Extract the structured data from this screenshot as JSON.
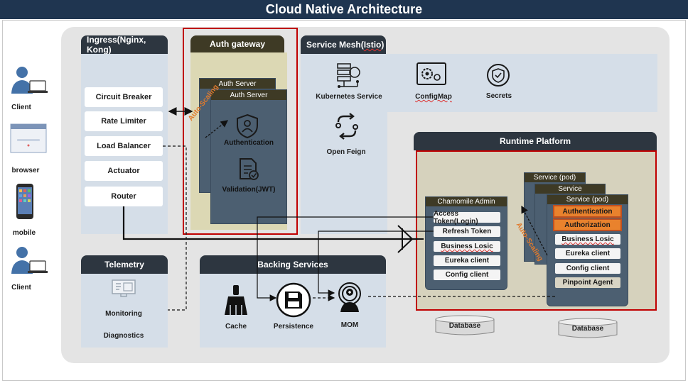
{
  "title": "Cloud Native Architecture",
  "clients": [
    {
      "label": "Client",
      "icon": "person-laptop-icon"
    },
    {
      "label": "browser",
      "icon": "browser-window-icon"
    },
    {
      "label": "mobile",
      "icon": "mobile-phone-icon"
    },
    {
      "label": "Client",
      "icon": "person-laptop-icon"
    }
  ],
  "ingress": {
    "title": "Ingress(Nginx, Kong)",
    "items": [
      "Circuit Breaker",
      "Rate Limiter",
      "Load Balancer",
      "Actuator",
      "Router"
    ]
  },
  "auth_gateway": {
    "title": "Auth  gateway",
    "back_card": "Auth Server",
    "front_card": "Auth Server",
    "auto_scaling": "Auto-Scaling",
    "authentication": "Authentication",
    "validation": "Validation(JWT)"
  },
  "service_mesh": {
    "title_prefix": "Service Mesh(",
    "title_mid": "Istio",
    "title_suffix": ")",
    "items": [
      "Kubernetes Service",
      "ConfigMap",
      "Secrets",
      "Open Feign"
    ]
  },
  "runtime": {
    "title": "Runtime Platform",
    "admin": {
      "title": "Chamomile Admin",
      "items": [
        "Access Token(Login)",
        "Refresh Token",
        "Business Losic",
        "Eureka client",
        "Config client"
      ]
    },
    "pods": {
      "back": "Service (pod)",
      "mid": "Service",
      "front": "Service (pod)",
      "auto_scaling": "Auto-Scaling",
      "highlight": [
        "Authentication",
        "Authorization"
      ],
      "items": [
        "Business Losic",
        "Eureka client",
        "Config client",
        "Pinpoint Agent"
      ]
    },
    "databases": [
      "Database",
      "Database"
    ]
  },
  "telemetry": {
    "title": "Telemetry",
    "items": [
      "Monitoring",
      "Diagnostics"
    ]
  },
  "backing": {
    "title": "Backing Services",
    "items": [
      "Cache",
      "Persistence",
      "MOM"
    ]
  },
  "colors": {
    "title_bar": "#1f3550",
    "header": "#2d3640",
    "panel": "#d5dee8",
    "auth_bg": "#dcd8b4",
    "card": "#4c5f71",
    "highlight": "#e9822d",
    "red_border": "#c00000",
    "auto_scaling_text": "#e07a2c"
  }
}
